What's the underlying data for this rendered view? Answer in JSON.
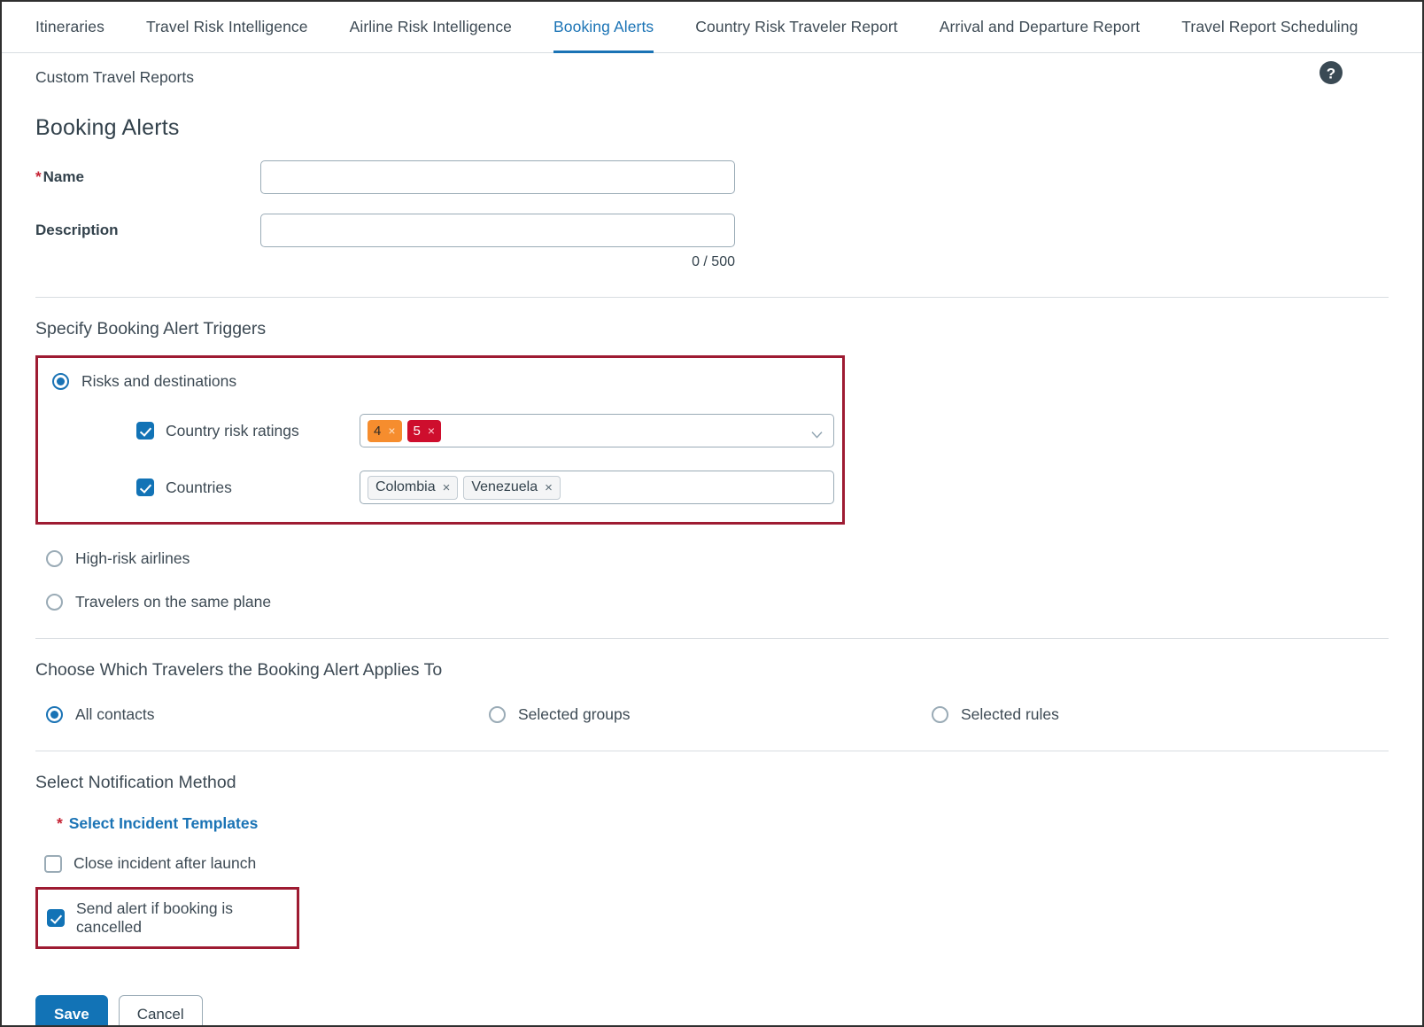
{
  "tabs": [
    {
      "label": "Itineraries",
      "active": false
    },
    {
      "label": "Travel Risk Intelligence",
      "active": false
    },
    {
      "label": "Airline Risk Intelligence",
      "active": false
    },
    {
      "label": "Booking Alerts",
      "active": true
    },
    {
      "label": "Country Risk Traveler Report",
      "active": false
    },
    {
      "label": "Arrival and Departure Report",
      "active": false
    },
    {
      "label": "Travel Report Scheduling",
      "active": false
    }
  ],
  "subheader": {
    "link_label": "Custom Travel Reports",
    "help_icon": "help-circle-icon"
  },
  "page_title": "Booking Alerts",
  "form": {
    "name": {
      "label": "Name",
      "required_marker": "*",
      "value": "",
      "placeholder": ""
    },
    "description": {
      "label": "Description",
      "value": "",
      "placeholder": "",
      "char_count": "0 / 500"
    }
  },
  "triggers": {
    "section_title": "Specify Booking Alert Triggers",
    "options": [
      {
        "label": "Risks and destinations",
        "selected": true
      },
      {
        "label": "High-risk airlines",
        "selected": false
      },
      {
        "label": "Travelers on the same plane",
        "selected": false
      }
    ],
    "country_risk_ratings": {
      "label": "Country risk ratings",
      "checked": true,
      "chips": [
        {
          "label": "4",
          "remove_icon": "×",
          "color": "#f68d2e"
        },
        {
          "label": "5",
          "remove_icon": "×",
          "color": "#ce0e2d"
        }
      ],
      "dropdown_icon": "chevron-down-icon"
    },
    "countries": {
      "label": "Countries",
      "checked": true,
      "chips": [
        {
          "label": "Colombia",
          "remove_icon": "×"
        },
        {
          "label": "Venezuela",
          "remove_icon": "×"
        }
      ]
    }
  },
  "travelers": {
    "section_title": "Choose Which Travelers the Booking Alert Applies To",
    "options": [
      {
        "label": "All contacts",
        "selected": true
      },
      {
        "label": "Selected groups",
        "selected": false
      },
      {
        "label": "Selected rules",
        "selected": false
      }
    ]
  },
  "notification": {
    "section_title": "Select Notification Method",
    "incident_templates": {
      "required_marker": "*",
      "label": "Select Incident Templates"
    },
    "close_incident": {
      "label": "Close incident after launch",
      "checked": false
    },
    "send_alert_cancelled": {
      "label": "Send alert if booking is cancelled",
      "checked": true
    }
  },
  "actions": {
    "save_label": "Save",
    "cancel_label": "Cancel"
  },
  "colors": {
    "accent_blue": "#1273b6",
    "highlight_red": "#9e1b32",
    "required_star": "#c52233",
    "rating_4": "#f68d2e",
    "rating_5": "#ce0e2d",
    "help_icon": "#3a4a54"
  }
}
